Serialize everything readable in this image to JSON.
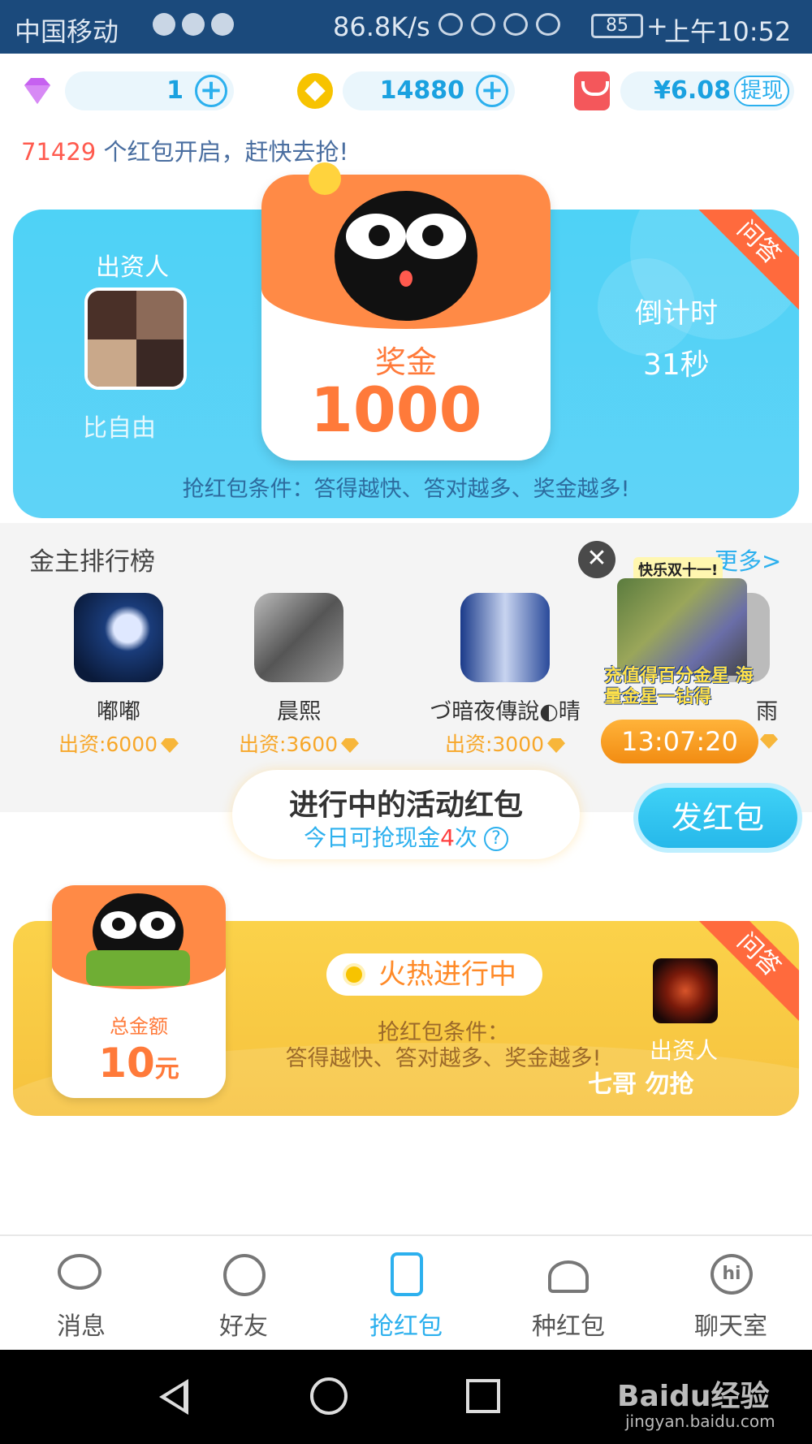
{
  "statusbar": {
    "carrier": "中国移动",
    "netspeed": "86.8K/s",
    "battery": "85",
    "time": "上午10:52"
  },
  "topbar": {
    "gems": "1",
    "coins": "14880",
    "cash": "¥6.08",
    "withdraw_label": "提现"
  },
  "notice": {
    "count": "71429",
    "text": " 个红包开启，赶快去抢!"
  },
  "hero": {
    "tag": "问答",
    "sponsor_label": "出资人",
    "sponsor_name": "比自由",
    "prize_label": "奖金",
    "prize_amount": "1000",
    "countdown_label": "倒计时",
    "countdown_value": "31秒",
    "condition": "抢红包条件：答得越快、答对越多、奖金越多!"
  },
  "ranking": {
    "title": "金主排行榜",
    "more": "更多>",
    "items": [
      {
        "name": "嘟嘟",
        "amount": "出资:6000"
      },
      {
        "name": "晨熙",
        "amount": "出资:3600"
      },
      {
        "name": "づ暗夜傳說◐晴",
        "amount": "出资:3000"
      },
      {
        "name": "雨",
        "amount": ""
      }
    ]
  },
  "promo": {
    "top": "快乐双十一!",
    "text": "充值得百分金星 海量金星一钻得",
    "timer": "13:07:20",
    "close": "✕"
  },
  "active": {
    "title": "进行中的活动红包",
    "sub_prefix": "今日可抢现金",
    "sub_count": "4",
    "sub_suffix": "次",
    "help": "?"
  },
  "send_button": "发红包",
  "gold_card": {
    "tag": "问答",
    "status": "火热进行中",
    "condition_line1": "抢红包条件：",
    "condition_line2": "答得越快、答对越多、奖金越多!",
    "total_label": "总金额",
    "total_amount": "10",
    "total_unit": "元",
    "sponsor_label": "出资人",
    "sponsor_name": "七哥 勿抢"
  },
  "nav": {
    "items": [
      {
        "label": "消息"
      },
      {
        "label": "好友"
      },
      {
        "label": "抢红包"
      },
      {
        "label": "种红包"
      },
      {
        "label": "聊天室"
      }
    ]
  },
  "watermark": {
    "text": "Baidu经验",
    "url": "jingyan.baidu.com"
  },
  "colors": {
    "accent": "#2cb0ee",
    "hero_bg": "#4ed2f6",
    "prize_orange": "#ff7a3a",
    "gold_card": "#f6c23e",
    "statusbar": "#1b4a7c"
  }
}
